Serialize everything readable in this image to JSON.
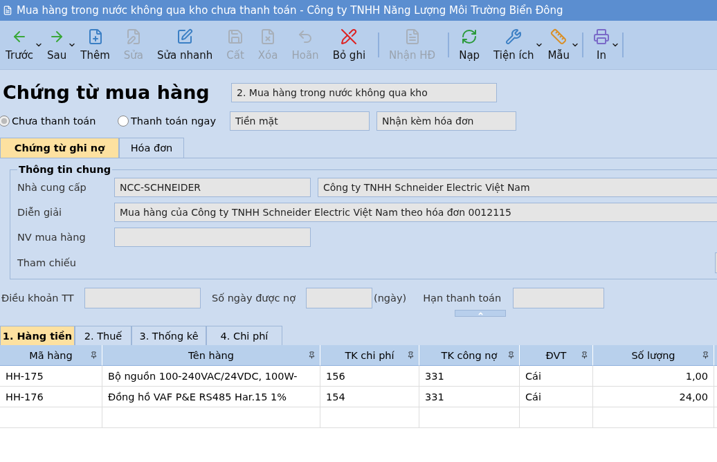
{
  "window": {
    "title": "Mua hàng trong nước không qua kho chưa thanh toán - Công ty TNHH Năng Lượng Môi Trường Biển Đông"
  },
  "toolbar": [
    {
      "kind": "button",
      "label": "Trước",
      "disabled": false,
      "dropdown": true
    },
    {
      "kind": "button",
      "label": "Sau",
      "disabled": false,
      "dropdown": true
    },
    {
      "kind": "button",
      "label": "Thêm",
      "disabled": false,
      "dropdown": false
    },
    {
      "kind": "button",
      "label": "Sửa",
      "disabled": true,
      "dropdown": false
    },
    {
      "kind": "button",
      "label": "Sửa nhanh",
      "disabled": false,
      "dropdown": false
    },
    {
      "kind": "button",
      "label": "Cất",
      "disabled": true,
      "dropdown": false
    },
    {
      "kind": "button",
      "label": "Xóa",
      "disabled": true,
      "dropdown": false
    },
    {
      "kind": "button",
      "label": "Hoãn",
      "disabled": true,
      "dropdown": false
    },
    {
      "kind": "button",
      "label": "Bỏ ghi",
      "disabled": false,
      "dropdown": false
    },
    {
      "kind": "separator"
    },
    {
      "kind": "button",
      "label": "Nhận HĐ",
      "disabled": true,
      "dropdown": false
    },
    {
      "kind": "separator"
    },
    {
      "kind": "button",
      "label": "Nạp",
      "disabled": false,
      "dropdown": false
    },
    {
      "kind": "button",
      "label": "Tiện ích",
      "disabled": false,
      "dropdown": true
    },
    {
      "kind": "button",
      "label": "Mẫu",
      "disabled": false,
      "dropdown": true
    },
    {
      "kind": "separator"
    },
    {
      "kind": "button",
      "label": "In",
      "disabled": false,
      "dropdown": true
    },
    {
      "kind": "separator"
    }
  ],
  "heading": "Chứng từ mua hàng",
  "type_field": "2. Mua hàng trong nước không qua kho",
  "payment_options": [
    {
      "label": "Chưa thanh toán",
      "selected": true
    },
    {
      "label": "Thanh toán ngay",
      "selected": false
    }
  ],
  "payment_method_field": "Tiền mặt",
  "invoice_field": "Nhận kèm hóa đơn",
  "tabs": [
    {
      "label": "Chứng từ ghi nợ",
      "selected": true
    },
    {
      "label": "Hóa đơn",
      "selected": false
    }
  ],
  "general_info": {
    "title": "Thông tin chung",
    "supplier_label": "Nhà cung cấp",
    "supplier_code": "NCC-SCHNEIDER",
    "supplier_name": "Công ty TNHH Schneider Electric Việt Nam",
    "description_label": "Diễn giải",
    "description": "Mua hàng của Công ty TNHH Schneider Electric Việt Nam theo hóa đơn 0012115",
    "buyer_label": "NV mua hàng",
    "reference_label": "Tham chiếu"
  },
  "terms": {
    "terms_label": "Điều khoản TT",
    "days_label": "Số ngày được nợ",
    "days_unit": "(ngày)",
    "due_label": "Hạn thanh toán"
  },
  "detail_tabs": [
    {
      "label": "1. Hàng tiền",
      "selected": true
    },
    {
      "label": "2. Thuế",
      "selected": false
    },
    {
      "label": "3. Thống kê",
      "selected": false
    },
    {
      "label": "4. Chi phí",
      "selected": false
    }
  ],
  "table": {
    "columns": [
      "Mã hàng",
      "Tên hàng",
      "TK chi phí",
      "TK công nợ",
      "ĐVT",
      "Số lượng"
    ],
    "rows": [
      [
        "HH-175",
        "Bộ nguồn 100-240VAC/24VDC, 100W-",
        "156",
        "331",
        "Cái",
        "1,00"
      ],
      [
        "HH-176",
        "Đồng hồ VAF P&E RS485 Har.15 1%",
        "154",
        "331",
        "Cái",
        "24,00"
      ]
    ]
  }
}
